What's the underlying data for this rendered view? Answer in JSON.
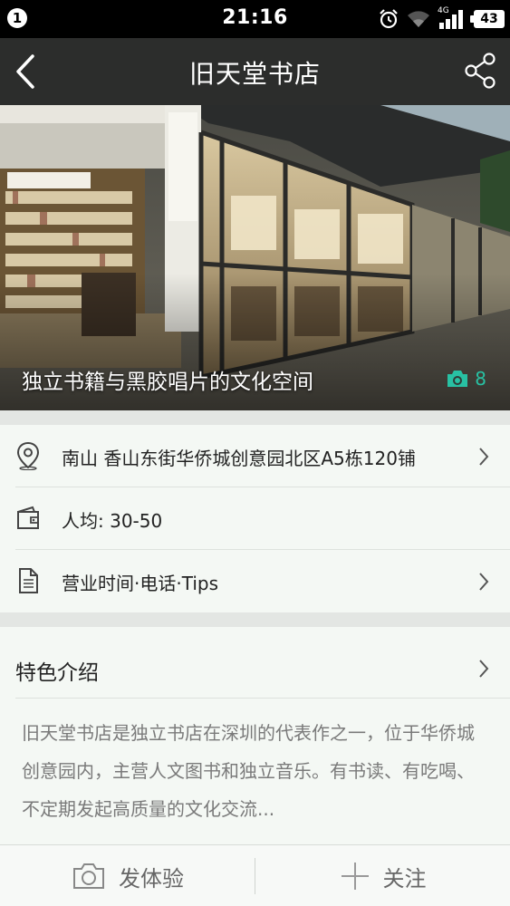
{
  "status_bar": {
    "notification_count": "1",
    "time": "21:16",
    "network_label": "4G",
    "battery": "43"
  },
  "header": {
    "title": "旧天堂书店",
    "back_icon": "back-arrow-icon",
    "share_icon": "share-icon"
  },
  "hero": {
    "caption": "独立书籍与黑胶唱片的文化空间",
    "photo_count": "8",
    "photo_count_color": "#28c1a3"
  },
  "info": {
    "address": "南山 香山东街华侨城创意园北区A5栋120铺",
    "price": "人均: 30-50",
    "hours": "营业时间·电话·Tips"
  },
  "feature": {
    "title": "特色介绍",
    "description": "旧天堂书店是独立书店在深圳的代表作之一，位于华侨城创意园内，主营人文图书和独立音乐。有书读、有吃喝、不定期发起高质量的文化交流..."
  },
  "bottom_bar": {
    "post_label": "发体验",
    "follow_label": "关注"
  },
  "colors": {
    "header_bg": "#2c2d2c",
    "accent": "#28c1a3",
    "page_bg": "#f4f8f4"
  }
}
